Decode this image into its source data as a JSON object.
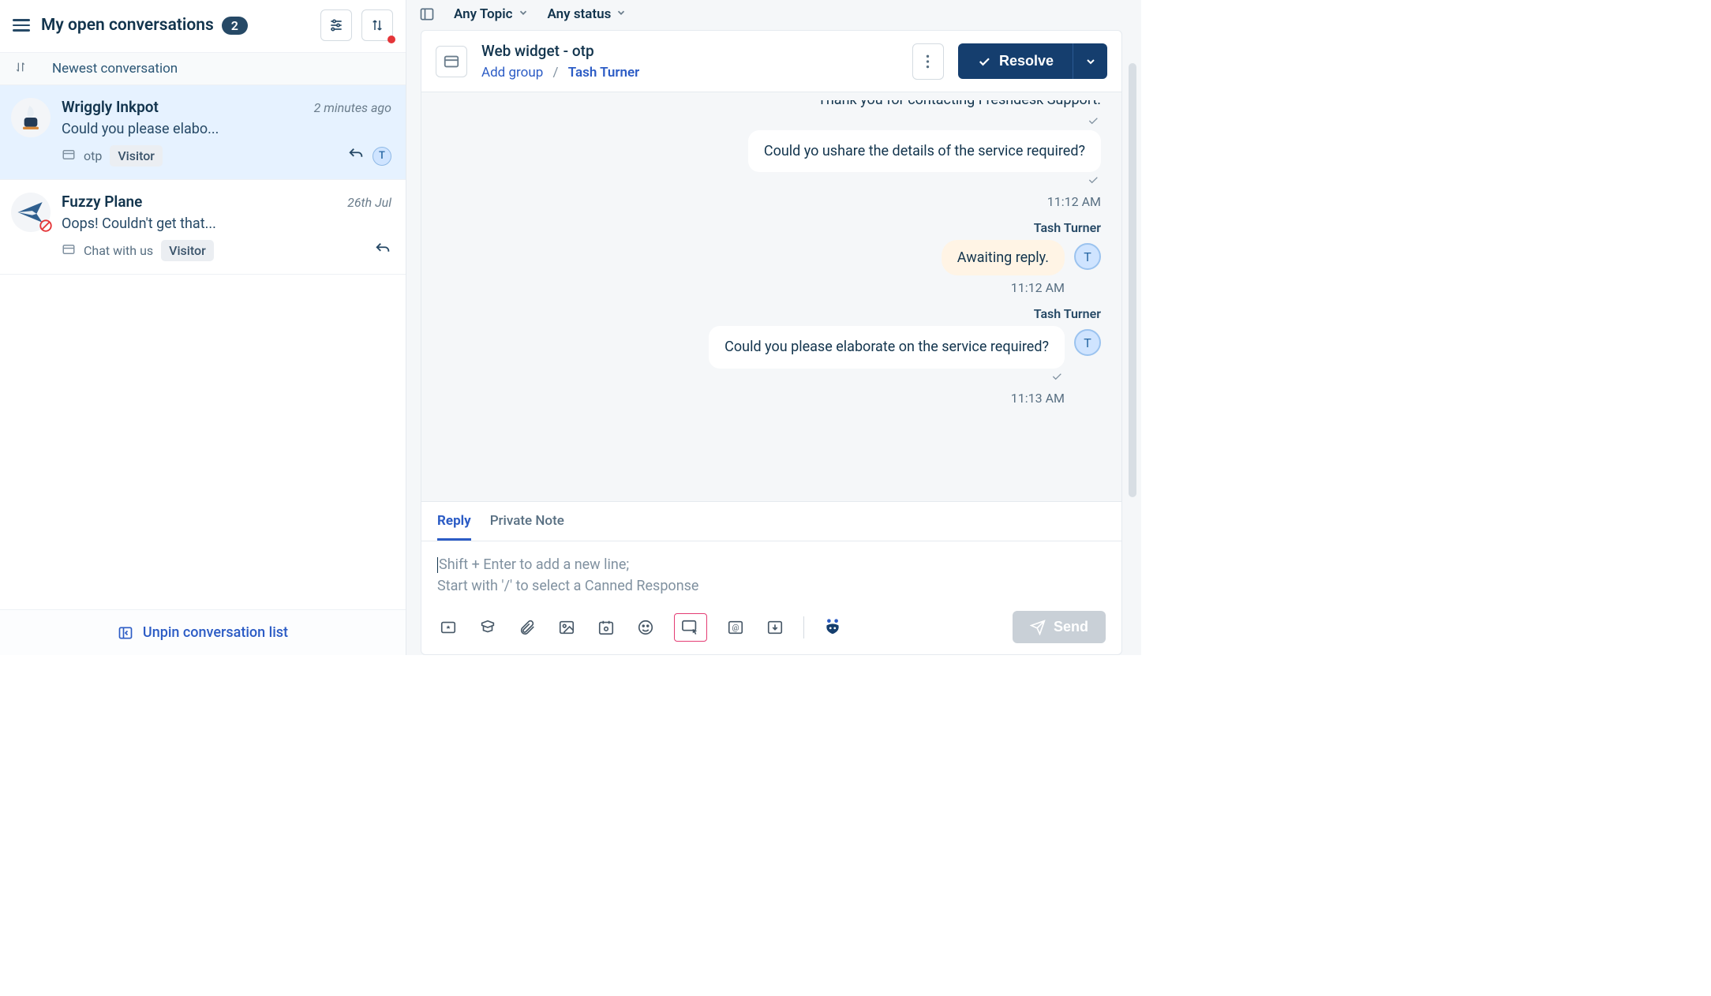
{
  "left": {
    "title": "My open conversations",
    "count": "2",
    "sort_label": "Newest conversation",
    "unpin": "Unpin conversation list",
    "items": [
      {
        "name": "Wriggly Inkpot",
        "time": "2 minutes ago",
        "preview": "Could you please elabo...",
        "channel": "otp",
        "badge": "Visitor",
        "assigned_initial": "T",
        "avatar_emoji": "inkpot"
      },
      {
        "name": "Fuzzy Plane",
        "time": "26th Jul",
        "preview": "Oops! Couldn't get that...",
        "channel": "Chat with us",
        "badge": "Visitor",
        "assigned_initial": "",
        "avatar_emoji": "plane"
      }
    ]
  },
  "filters": {
    "topic": "Any Topic",
    "status": "Any status"
  },
  "header": {
    "title": "Web widget - otp",
    "add_group": "Add group",
    "agent": "Tash Turner",
    "resolve": "Resolve"
  },
  "chat": {
    "cutoff": "Thank you for contacting Freshdesk Support.",
    "msgs": [
      {
        "type": "bubble",
        "text": "Could yo ushare the details of the service required?",
        "time": "11:12 AM"
      },
      {
        "type": "sender",
        "name": "Tash Turner"
      },
      {
        "type": "amber",
        "text": "Awaiting reply.",
        "time": "11:12 AM",
        "avatar": "T"
      },
      {
        "type": "sender",
        "name": "Tash Turner"
      },
      {
        "type": "bubble",
        "text": "Could you please elaborate on the service required?",
        "time": "11:13 AM",
        "avatar": "T"
      }
    ]
  },
  "composer": {
    "tabs": {
      "reply": "Reply",
      "note": "Private Note"
    },
    "placeholder1": "Shift + Enter to add a new line;",
    "placeholder2": "Start with '/' to select a Canned Response",
    "send": "Send"
  }
}
